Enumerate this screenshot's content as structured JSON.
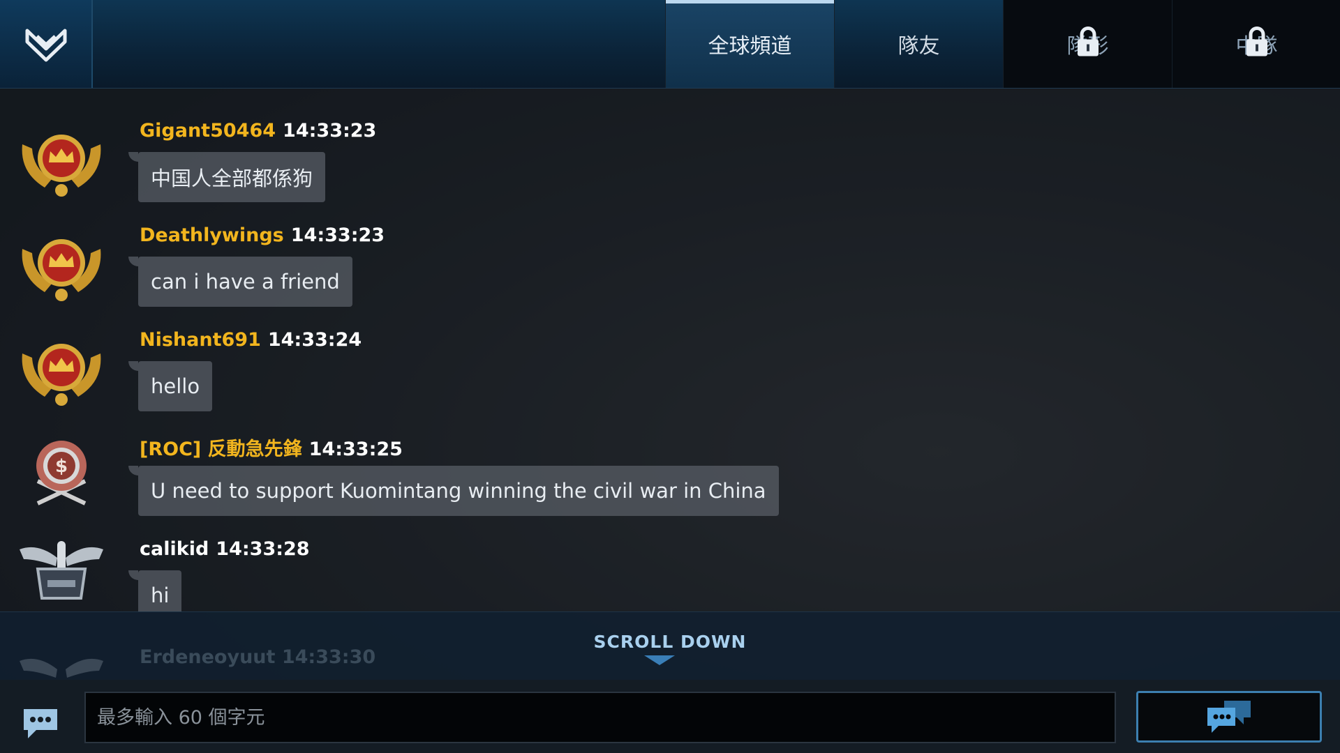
{
  "tabs": [
    {
      "label": "全球頻道",
      "active": true,
      "locked": false
    },
    {
      "label": "隊友",
      "active": false,
      "locked": false
    },
    {
      "label": "隊形",
      "active": false,
      "locked": true
    },
    {
      "label": "中隊",
      "active": false,
      "locked": true
    }
  ],
  "messages": [
    {
      "name": "Gigant50464",
      "time": "14:33:23",
      "text": "中国人全部都係狗",
      "name_color": "#f2b51e",
      "avatar": "gold-crown-emblem-icon"
    },
    {
      "name": "Deathlywings",
      "time": "14:33:23",
      "text": "can i have a friend",
      "name_color": "#f2b51e",
      "avatar": "gold-crown-emblem-icon"
    },
    {
      "name": "Nishant691",
      "time": "14:33:24",
      "text": "hello",
      "name_color": "#f2b51e",
      "avatar": "gold-crown-emblem-icon"
    },
    {
      "name": "[ROC] 反動急先鋒",
      "time": "14:33:25",
      "text": "U need to support Kuomintang winning the civil war in China",
      "name_color": "#f2b51e",
      "avatar": "bronze-dollar-medal-icon"
    },
    {
      "name": "calikid",
      "time": "14:33:28",
      "text": "hi",
      "name_color": "#ffffff",
      "avatar": "silver-winged-bullet-icon"
    }
  ],
  "ghost_message": {
    "name": "Erdeneoyuut",
    "time": "14:33:30"
  },
  "scroll": {
    "label": "SCROLL DOWN"
  },
  "input": {
    "placeholder": "最多輸入 60 個字元",
    "value": ""
  },
  "colors": {
    "accent": "#3c7fb0",
    "username": "#f2b51e",
    "topbar": "#0e3552"
  }
}
